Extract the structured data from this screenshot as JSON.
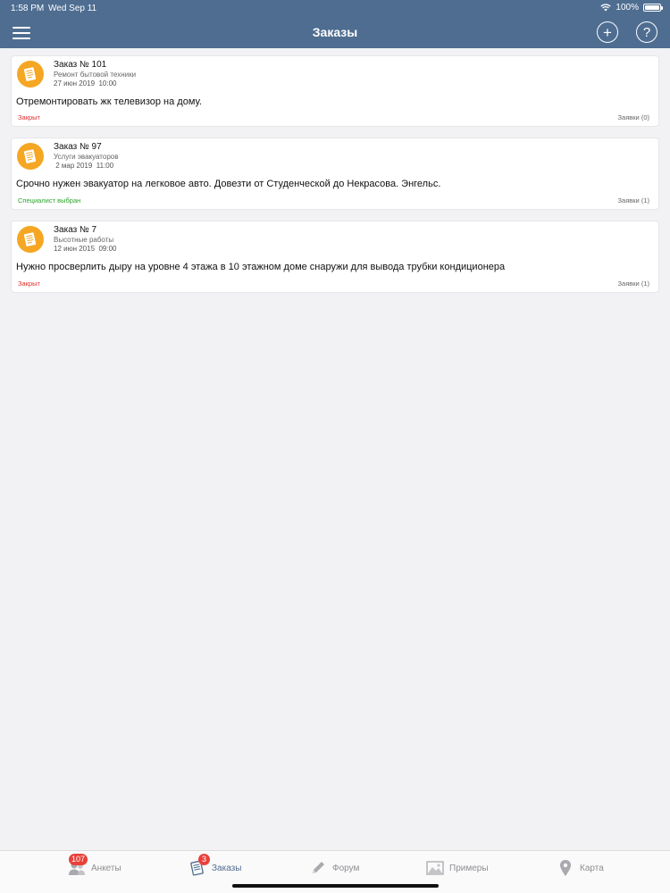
{
  "status_bar": {
    "time": "1:58 PM",
    "date": "Wed Sep 11",
    "battery": "100%"
  },
  "header": {
    "title": "Заказы"
  },
  "orders": [
    {
      "title": "Заказ № 101",
      "category": "Ремонт бытовой техники",
      "date": "27 июн 2019  10:00",
      "description": "Отремонтировать жк телевизор на дому.",
      "status": "Закрыт",
      "status_color": "#e03030",
      "bids": "Заявки (0)"
    },
    {
      "title": "Заказ № 97",
      "category": "Услуги эвакуаторов",
      "date": " 2 мар 2019  11:00",
      "description": "Срочно нужен эвакуатор на легковое авто. Довезти от Студенческой до Некрасова. Энгельс.",
      "status": "Специалист выбран",
      "status_color": "#2aa52a",
      "bids": "Заявки (1)"
    },
    {
      "title": "Заказ № 7",
      "category": "Высотные работы",
      "date": "12 июн 2015  09:00",
      "description": "Нужно просверлить дыру на уровне 4 этажа в 10 этажном доме снаружи для вывода трубки кондиционера",
      "status": "Закрыт",
      "status_color": "#e03030",
      "bids": "Заявки (1)"
    }
  ],
  "tabbar": {
    "tabs": [
      {
        "label": "Анкеты",
        "badge": "107",
        "icon": "people-icon"
      },
      {
        "label": "Заказы",
        "badge": "3",
        "icon": "orders-icon"
      },
      {
        "label": "Форум",
        "icon": "pencil-icon"
      },
      {
        "label": "Примеры",
        "icon": "picture-icon"
      },
      {
        "label": "Карта",
        "icon": "map-pin-icon"
      }
    ],
    "active": "Заказы"
  },
  "colors": {
    "header": "#4e6d91",
    "avatar": "#f5a623",
    "badge": "#e8413a"
  }
}
